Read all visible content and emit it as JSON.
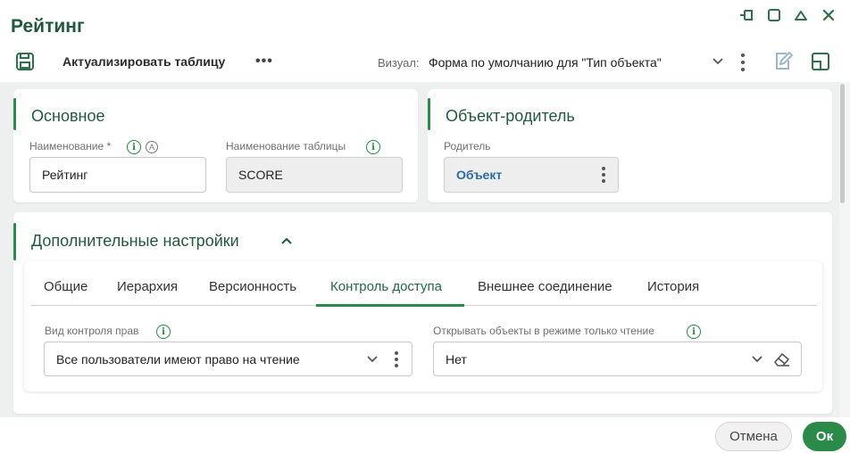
{
  "window": {
    "title": "Рейтинг"
  },
  "toolbar": {
    "refresh_label": "Актуализировать таблицу",
    "more_label": "•••",
    "visual_label": "Визуал:",
    "visual_value": "Форма по умолчанию для \"Тип объекта\""
  },
  "main_section": {
    "title": "Основное",
    "name_label": "Наименование",
    "name_required": "*",
    "name_value": "Рейтинг",
    "table_label": "Наименование таблицы",
    "table_value": "SCORE"
  },
  "parent_section": {
    "title": "Объект-родитель",
    "parent_label": "Родитель",
    "parent_value": "Объект"
  },
  "extra_section": {
    "title": "Дополнительные настройки",
    "tabs": [
      "Общие",
      "Иерархия",
      "Версионность",
      "Контроль доступа",
      "Внешнее соединение",
      "История"
    ],
    "active_tab": "Контроль доступа",
    "access_label": "Вид контроля прав",
    "access_value": "Все пользователи имеют право на чтение",
    "readonly_label": "Открывать объекты в режиме только чтение",
    "readonly_value": "Нет"
  },
  "footer": {
    "cancel_label": "Отмена",
    "ok_label": "Ок"
  },
  "icons": {
    "info": "i",
    "auto": "A"
  },
  "colors": {
    "accent": "#2a8a48",
    "title": "#1f5a3a",
    "link": "#2a6aa8",
    "info": "#1e8a3a"
  }
}
